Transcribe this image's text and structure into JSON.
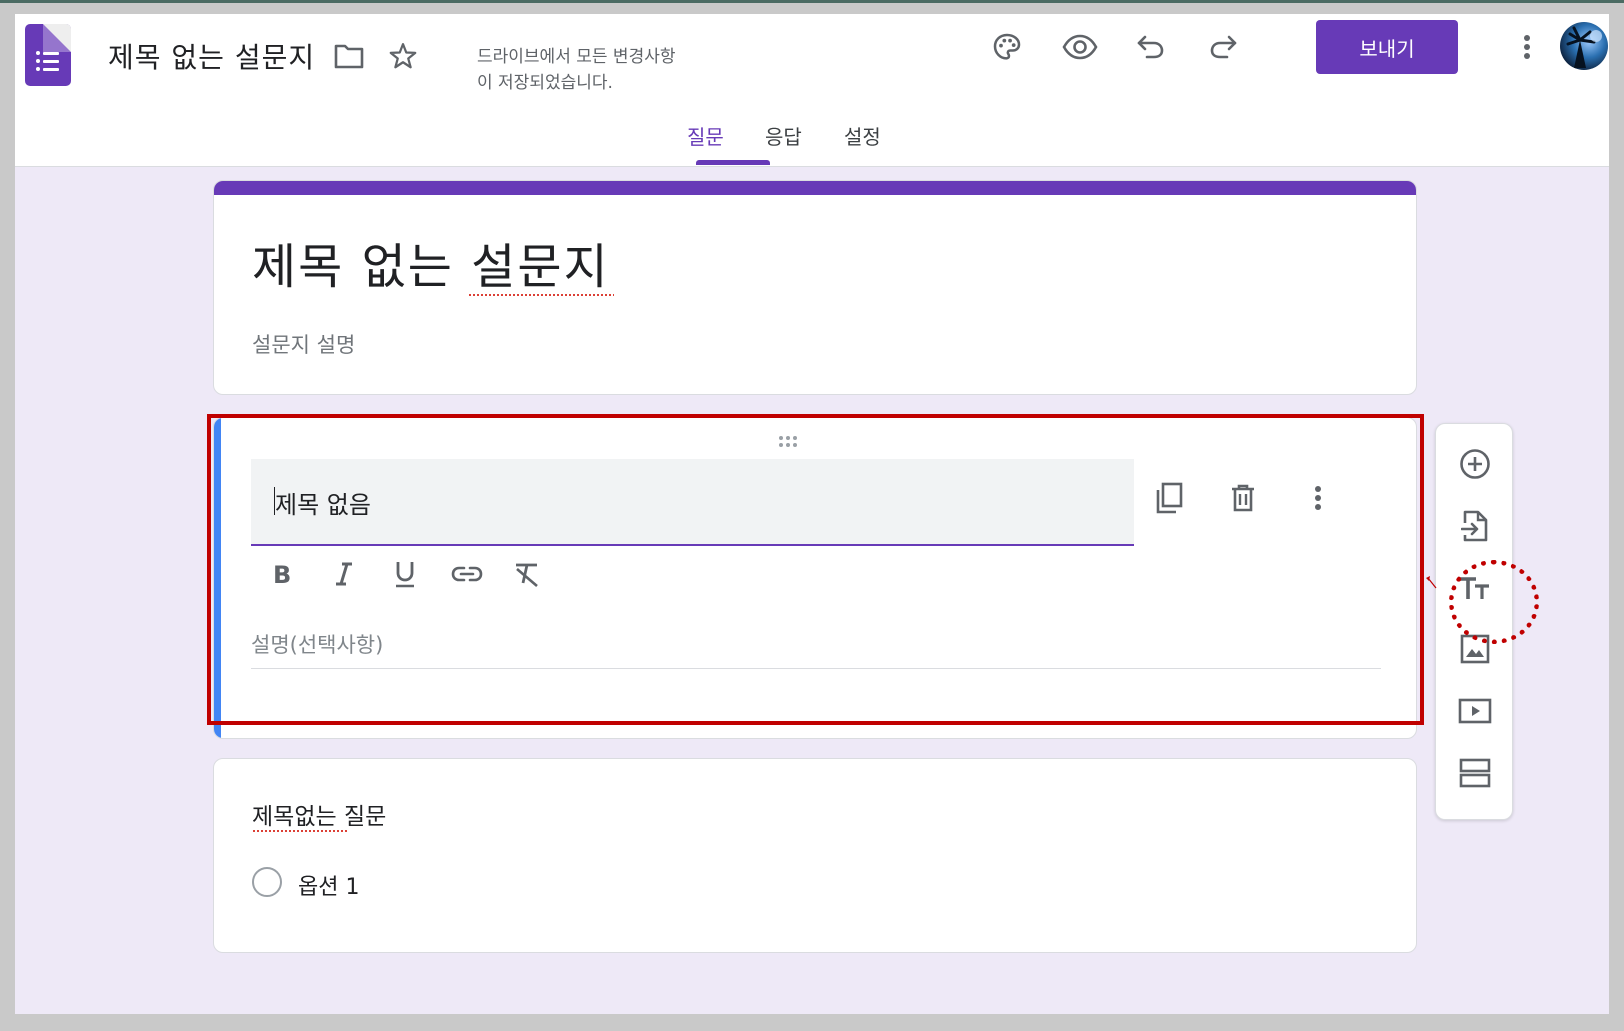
{
  "header": {
    "doc_title": "제목 없는 설문지",
    "save_status_line1": "드라이브에서 모든 변경사항",
    "save_status_line2": "이 저장되었습니다.",
    "send_label": "보내기"
  },
  "tabs": [
    {
      "label": "질문",
      "active": true
    },
    {
      "label": "응답",
      "active": false
    },
    {
      "label": "설정",
      "active": false
    }
  ],
  "form": {
    "title": "제목 없는 설문지",
    "description_placeholder": "설문지 설명"
  },
  "section": {
    "title_value": "제목 없음",
    "description_placeholder": "설명(선택사항)",
    "format_buttons": [
      "bold",
      "italic",
      "underline",
      "link",
      "clear-formatting"
    ]
  },
  "question": {
    "title": "제목없는 질문",
    "options": [
      "옵션 1"
    ]
  },
  "side_toolbar": [
    "add-question",
    "import-questions",
    "add-title-and-description",
    "add-image",
    "add-video",
    "add-section"
  ],
  "colors": {
    "accent": "#673ab7",
    "background": "#eee9f7",
    "section_bar": "#4285f4",
    "highlight": "#c00000"
  }
}
